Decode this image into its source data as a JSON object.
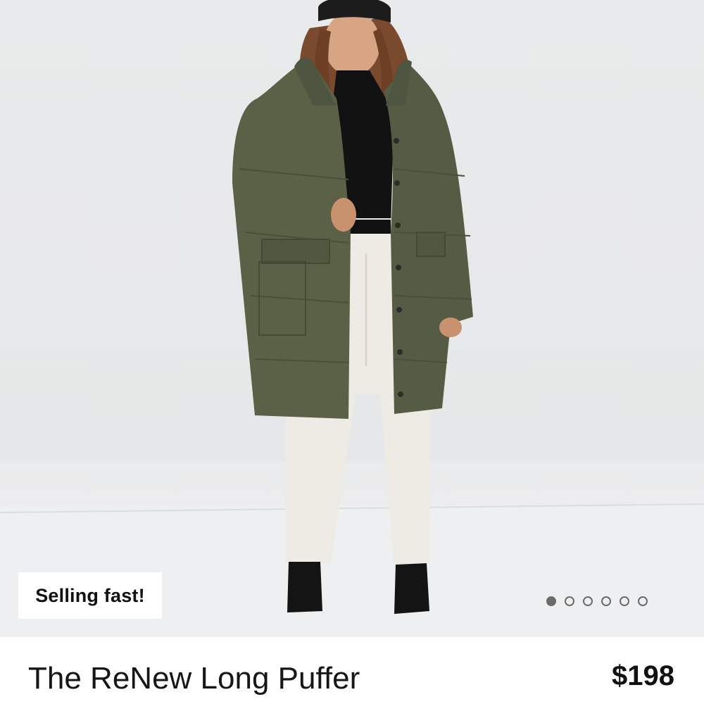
{
  "image": {
    "alt": "Model wearing an olive green long puffer coat with a black beanie, black turtleneck, white trousers and black ankle boots",
    "colors": {
      "backdrop": "#e9eaeb",
      "coat": "#5a6147",
      "trousers": "#eeebe4"
    }
  },
  "badge": {
    "label": "Selling fast!"
  },
  "carousel": {
    "total": 6,
    "active_index": 0,
    "dot_color": "#6b6b6b"
  },
  "product": {
    "name": "The ReNew Long Puffer",
    "price": "$198"
  }
}
